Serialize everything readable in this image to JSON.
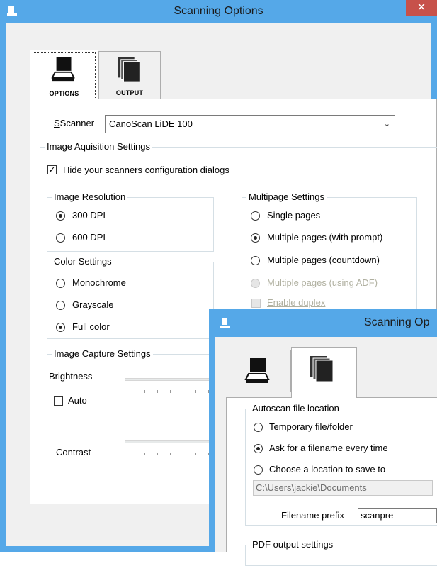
{
  "main_window": {
    "title": "Scanning Options",
    "close_label": "✕",
    "tabs": [
      {
        "label": "OPTIONS",
        "icon": "scanner-icon",
        "selected": true
      },
      {
        "label": "OUTPUT",
        "icon": "pages-stack-icon",
        "selected": false
      }
    ],
    "scanner_label": "Scanner",
    "scanner_value": "CanoScan LiDE 100",
    "acquisition_group": "Image Aquisition Settings",
    "hide_dialogs_label": "Hide your scanners configuration dialogs",
    "hide_dialogs_checked": true,
    "resolution_group": "Image Resolution",
    "resolutions": [
      {
        "label": "300 DPI",
        "selected": true
      },
      {
        "label": "600 DPI",
        "selected": false
      }
    ],
    "color_group": "Color Settings",
    "colors": [
      {
        "label": "Monochrome",
        "selected": false
      },
      {
        "label": "Grayscale",
        "selected": false
      },
      {
        "label": "Full color",
        "selected": true
      }
    ],
    "multipage_group": "Multipage Settings",
    "multipage": [
      {
        "label": "Single pages",
        "selected": false,
        "enabled": true
      },
      {
        "label": "Multiple pages (with prompt)",
        "selected": true,
        "enabled": true
      },
      {
        "label": "Multiple pages (countdown)",
        "selected": false,
        "enabled": true
      },
      {
        "label": "Multiple pages (using ADF)",
        "selected": false,
        "enabled": false
      }
    ],
    "duplex_label": "Enable duplex",
    "duplex_enabled": false,
    "capture_group": "Image Capture Settings",
    "brightness_label": "Brightness",
    "auto_label": "Auto",
    "auto_checked": false,
    "contrast_label": "Contrast"
  },
  "output_window": {
    "title": "Scanning Op",
    "tabs": [
      {
        "icon": "scanner-icon",
        "selected": false
      },
      {
        "icon": "pages-stack-icon",
        "selected": true
      }
    ],
    "autoscan_group": "Autoscan file location",
    "locations": [
      {
        "label": "Temporary file/folder",
        "selected": false
      },
      {
        "label": "Ask for a filename every time",
        "selected": true
      },
      {
        "label": "Choose a location to save to",
        "selected": false
      }
    ],
    "path_value": "C:\\Users\\jackie\\Documents",
    "prefix_label": "Filename prefix",
    "prefix_value": "scanpre",
    "pdf_group": "PDF output settings"
  },
  "colors": {
    "titlebar": "#55a8e8",
    "close_button": "#c7514a",
    "disabled_text": "#b0b0a0"
  }
}
